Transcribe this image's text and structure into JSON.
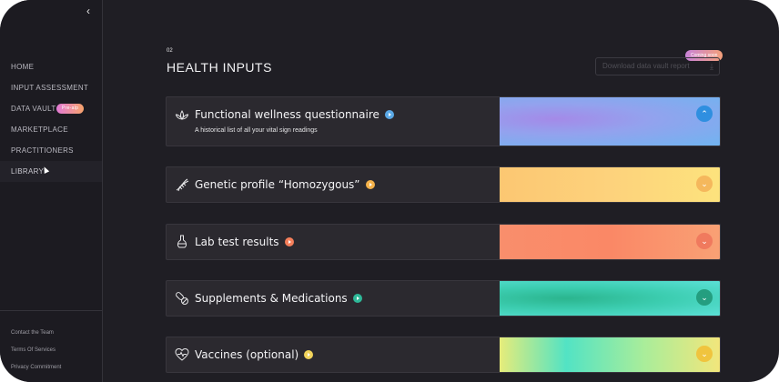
{
  "sidebar": {
    "collapse_glyph": "‹",
    "nav": [
      {
        "label": "HOME"
      },
      {
        "label": "INPUT ASSESSMENT"
      },
      {
        "label": "DATA VAULT",
        "badge": "Pre-alp"
      },
      {
        "label": "MARKETPLACE"
      },
      {
        "label": "PRACTITIONERS"
      },
      {
        "label": "LIBRARY"
      }
    ],
    "footer_links": [
      "Contact the Team",
      "Terms Of Services",
      "Privacy Commitment"
    ]
  },
  "main": {
    "section_number": "02",
    "section_title": "HEALTH INPUTS",
    "coming_soon_badge": "Coming soon",
    "download_button": "Download data vault report",
    "cards": [
      {
        "title": "Functional wellness questionnaire",
        "subtitle": "A historical list of all your vital sign readings",
        "icon": "lotus-icon",
        "expanded": true,
        "accent": "#5aa8e6"
      },
      {
        "title": "Genetic profile “Homozygous”",
        "icon": "dna-icon",
        "expanded": false,
        "accent": "#f5b24a"
      },
      {
        "title": "Lab test results",
        "icon": "flask-icon",
        "expanded": false,
        "accent": "#f57f5b"
      },
      {
        "title": "Supplements & Medications",
        "icon": "pills-icon",
        "expanded": false,
        "accent": "#2eb898"
      },
      {
        "title": "Vaccines (optional)",
        "icon": "heartbeat-icon",
        "expanded": false,
        "accent": "#f1d35a"
      }
    ]
  }
}
